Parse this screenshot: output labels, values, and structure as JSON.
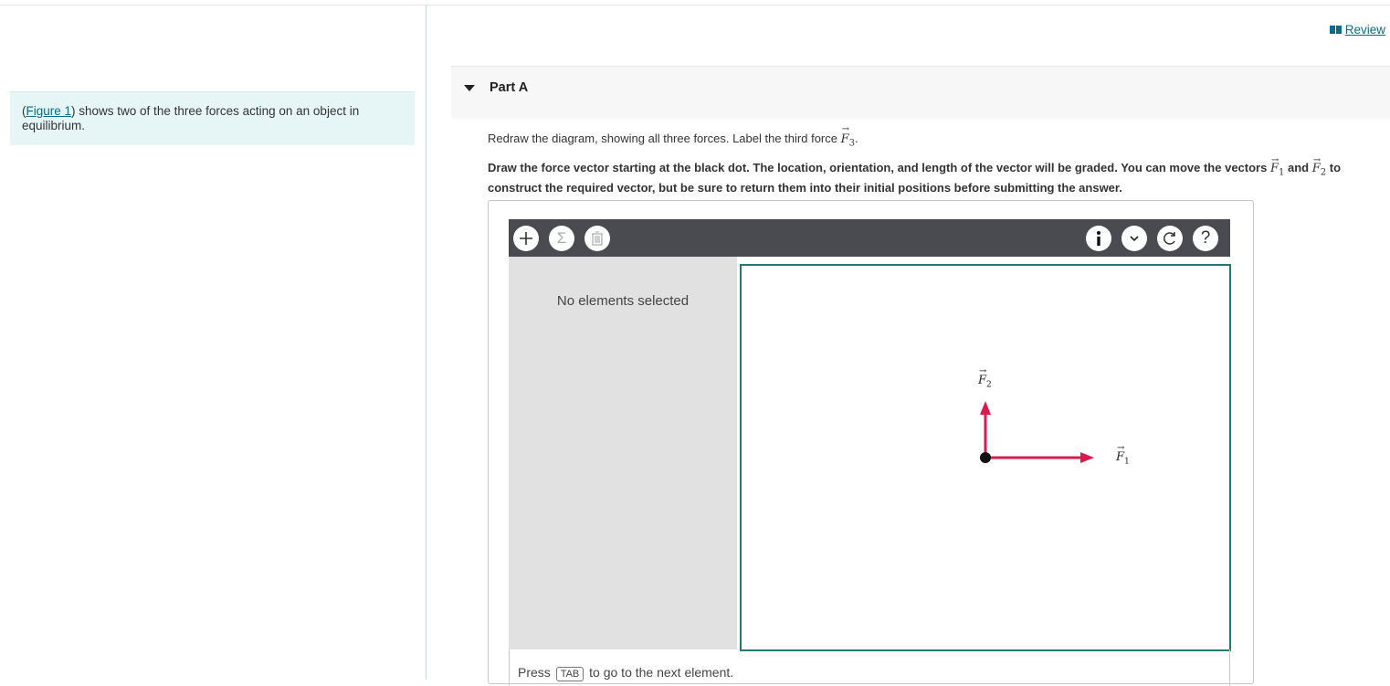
{
  "review": {
    "label": "Review"
  },
  "intro": {
    "figure_link": "Figure 1",
    "text_before": "(",
    "text_after": ") shows two of the three forces acting on an object in equilibrium."
  },
  "part": {
    "title": "Part A"
  },
  "instructions": {
    "line1_before": "Redraw the diagram, showing all three forces. Label the third force",
    "line1_vector": "F",
    "line1_sub": "3",
    "line1_after": ".",
    "line2_a": "Draw the force vector starting at the black dot. The location, orientation, and length of the vector will be graded. You can move the vectors",
    "line2_v1": "F",
    "line2_v1_sub": "1",
    "line2_and": "and",
    "line2_v2": "F",
    "line2_v2_sub": "2",
    "line2_b": "to construct the required vector, but be sure to return them into their initial positions before submitting the answer."
  },
  "toolbar": {
    "left_icons": [
      "plus-icon",
      "sigma-icon",
      "trash-icon"
    ],
    "right_icons": [
      "info-icon",
      "chevron-down-icon",
      "reset-icon",
      "help-icon"
    ],
    "glyphs": {
      "plus": "+",
      "sigma": "Σ",
      "info": "i",
      "chevron": "⌄",
      "help": "?"
    }
  },
  "side_panel": {
    "message": "No elements selected"
  },
  "canvas": {
    "vectors": [
      {
        "label": "F",
        "sub": "1",
        "direction": "right",
        "color": "#d81b4f"
      },
      {
        "label": "F",
        "sub": "2",
        "direction": "up",
        "color": "#d81b4f"
      }
    ],
    "dot_color": "#111111",
    "arrow_glyph": "→"
  },
  "footer": {
    "press": "Press",
    "key": "TAB",
    "rest": "to go to the next element."
  },
  "colors": {
    "link": "#0a6b8a",
    "canvas_border": "#1f7a78",
    "toolbar": "#4a4b51",
    "vector": "#d81b4f"
  }
}
